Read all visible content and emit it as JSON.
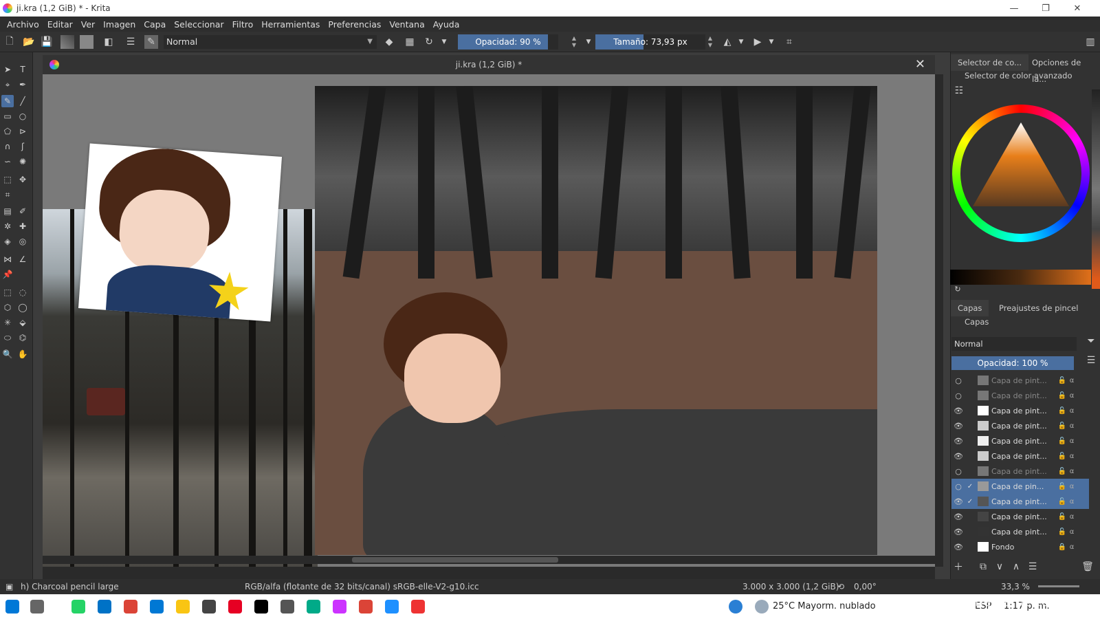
{
  "window": {
    "title": "ji.kra (1,2 GiB) * - Krita"
  },
  "menu": [
    "Archivo",
    "Editar",
    "Ver",
    "Imagen",
    "Capa",
    "Seleccionar",
    "Filtro",
    "Herramientas",
    "Preferencias",
    "Ventana",
    "Ayuda"
  ],
  "toolbar": {
    "blend_mode": "Normal",
    "opacity_label": "Opacidad: 90 %",
    "opacity_value": 0.9,
    "size_label": "Tamaño: 73,93 px"
  },
  "document": {
    "tab_title": "ji.kra (1,2 GiB) *"
  },
  "dockers": {
    "top_tabs": [
      "Selector de co...",
      "Opciones de la..."
    ],
    "color_selector_title": "Selector de color avanzado",
    "layer_tabs": [
      "Capas",
      "Preajustes de pincel"
    ],
    "layers_title": "Capas",
    "layer_blend": "Normal",
    "layer_opacity": "Opacidad:  100 %",
    "layers": [
      {
        "name": "Capa de pint...",
        "visible": false
      },
      {
        "name": "Capa de pint...",
        "visible": false
      },
      {
        "name": "Capa de pint...",
        "visible": true
      },
      {
        "name": "Capa de pint...",
        "visible": true
      },
      {
        "name": "Capa de pint...",
        "visible": true
      },
      {
        "name": "Capa de pint...",
        "visible": true
      },
      {
        "name": "Capa de pint...",
        "visible": false
      },
      {
        "name": "Capa de pin...",
        "visible": false,
        "selected": true,
        "checked": true
      },
      {
        "name": "Capa de pint...",
        "visible": true,
        "selected": true,
        "checked": true
      },
      {
        "name": "Capa de pint...",
        "visible": true
      },
      {
        "name": "Capa de pint...",
        "visible": true
      },
      {
        "name": "Fondo",
        "visible": true,
        "locked": true
      }
    ]
  },
  "status": {
    "brush": "h) Charcoal pencil large",
    "color_space": "RGB/alfa (flotante de 32 bits/canal)  sRGB-elle-V2-g10.icc",
    "image_size": "3.000 x 3.000 (1,2 GiB)",
    "rotation": "0,00°",
    "zoom": "33,3 %"
  },
  "taskbar": {
    "weather": "25°C  Mayorm. nublado",
    "lang": "ESP",
    "time": "1:17 p. m.",
    "watermark": "@Bernardettevic"
  },
  "colors": {
    "accent": "#4a6fa0",
    "panel": "#323232",
    "canvas_bg": "#7a7a7a"
  }
}
